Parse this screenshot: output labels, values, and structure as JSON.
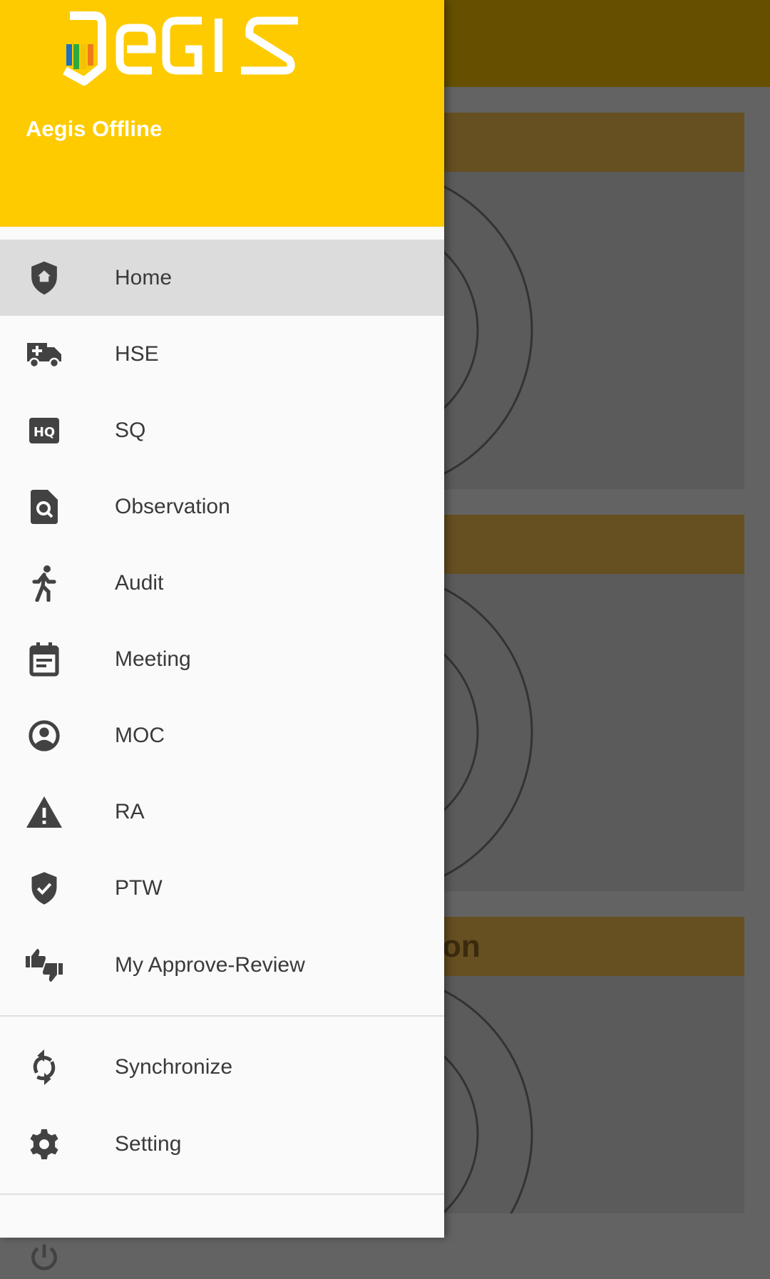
{
  "header": {
    "logo_text": "AEGIS",
    "app_name": "Aegis Offline"
  },
  "menu": [
    {
      "label": "Home",
      "icon": "shield-home-icon",
      "active": true
    },
    {
      "label": "HSE",
      "icon": "ambulance-icon"
    },
    {
      "label": "SQ",
      "icon": "hq-icon"
    },
    {
      "label": "Observation",
      "icon": "file-search-icon"
    },
    {
      "label": "Audit",
      "icon": "walking-icon"
    },
    {
      "label": "Meeting",
      "icon": "calendar-text-icon"
    },
    {
      "label": "MOC",
      "icon": "account-sync-icon"
    },
    {
      "label": "RA",
      "icon": "warning-icon"
    },
    {
      "label": "PTW",
      "icon": "shield-check-icon"
    },
    {
      "label": "My Approve-Review",
      "icon": "thumbs-up-down-icon"
    }
  ],
  "secondary": [
    {
      "label": "Synchronize",
      "icon": "sync-icon"
    },
    {
      "label": "Setting",
      "icon": "gear-icon"
    }
  ],
  "bottom": {
    "icon": "power-icon"
  },
  "background": {
    "card3_header_partial": "on"
  },
  "colors": {
    "header": "#fdcb00",
    "appbar_dimmed": "#665000",
    "active_item": "#dcdcdc"
  }
}
